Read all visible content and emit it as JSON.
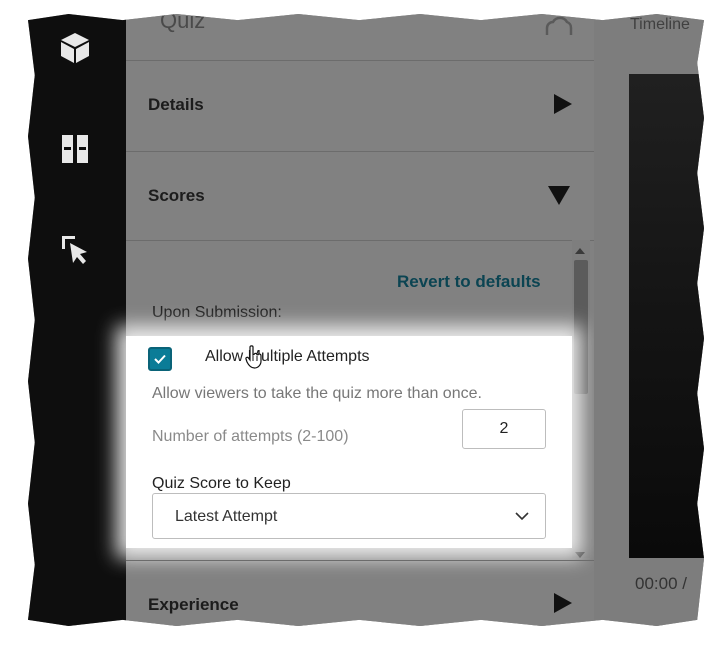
{
  "panel": {
    "title": "Quiz",
    "sections": {
      "details": "Details",
      "scores": "Scores",
      "experience": "Experience"
    }
  },
  "scores": {
    "revert_label": "Revert to defaults",
    "upon_submission_label": "Upon Submission:",
    "allow_multiple": {
      "label": "Allow Multiple Attempts",
      "checked": true,
      "description": "Allow viewers to take the quiz more than once."
    },
    "attempts": {
      "label": "Number of attempts (2-100)",
      "value": "2"
    },
    "keep": {
      "label": "Quiz Score to Keep",
      "selected": "Latest Attempt"
    }
  },
  "preview": {
    "title": "Timeline",
    "time": "00:00 /"
  },
  "colors": {
    "accent": "#0b7c97",
    "link": "#0b4452",
    "sidebar": "#0e0e0e"
  },
  "icons": {
    "sidebar": [
      "cube-icon",
      "book-icon",
      "cursor-select-icon"
    ],
    "panel": [
      "cloud-icon",
      "triangle-right-icon",
      "triangle-down-icon",
      "check-icon",
      "hand-cursor-icon",
      "chevron-down-icon"
    ]
  }
}
